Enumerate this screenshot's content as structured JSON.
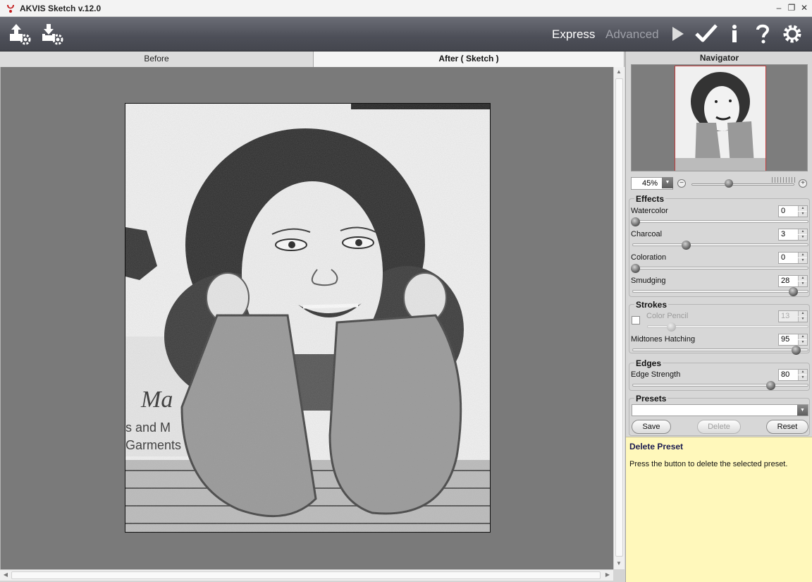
{
  "window": {
    "title": "AKVIS Sketch v.12.0",
    "controls": [
      "minimize-icon",
      "restore-icon",
      "close-icon"
    ]
  },
  "toolbar": {
    "left_icons": [
      "open-image-icon",
      "save-image-icon"
    ],
    "modes": {
      "express": "Express",
      "advanced": "Advanced",
      "active": "express"
    },
    "right_icons": [
      "run-icon",
      "apply-icon",
      "info-icon",
      "help-icon",
      "settings-icon"
    ]
  },
  "view_tabs": {
    "before": "Before",
    "after": "After ( Sketch )",
    "active": "after"
  },
  "navigator": {
    "title": "Navigator",
    "zoom": "45%",
    "zoom_slider_fraction": 0.36
  },
  "effects": {
    "title": "Effects",
    "params": [
      {
        "label": "Watercolor",
        "value": "0",
        "fraction": 0.0
      },
      {
        "label": "Charcoal",
        "value": "3",
        "fraction": 0.3
      },
      {
        "label": "Coloration",
        "value": "0",
        "fraction": 0.0
      },
      {
        "label": "Smudging",
        "value": "28",
        "fraction": 0.93
      }
    ]
  },
  "strokes": {
    "title": "Strokes",
    "color_pencil": {
      "label": "Color Pencil",
      "value": "13",
      "checked": false,
      "fraction": 0.13
    },
    "midtones": {
      "label": "Midtones Hatching",
      "value": "95",
      "fraction": 0.95
    }
  },
  "edges": {
    "title": "Edges",
    "edge_strength": {
      "label": "Edge Strength",
      "value": "80",
      "fraction": 0.8
    }
  },
  "presets": {
    "title": "Presets",
    "selected": "",
    "save": "Save",
    "delete": "Delete",
    "reset": "Reset"
  },
  "hint": {
    "title": "Delete Preset",
    "body": "Press the button to delete the selected preset."
  }
}
